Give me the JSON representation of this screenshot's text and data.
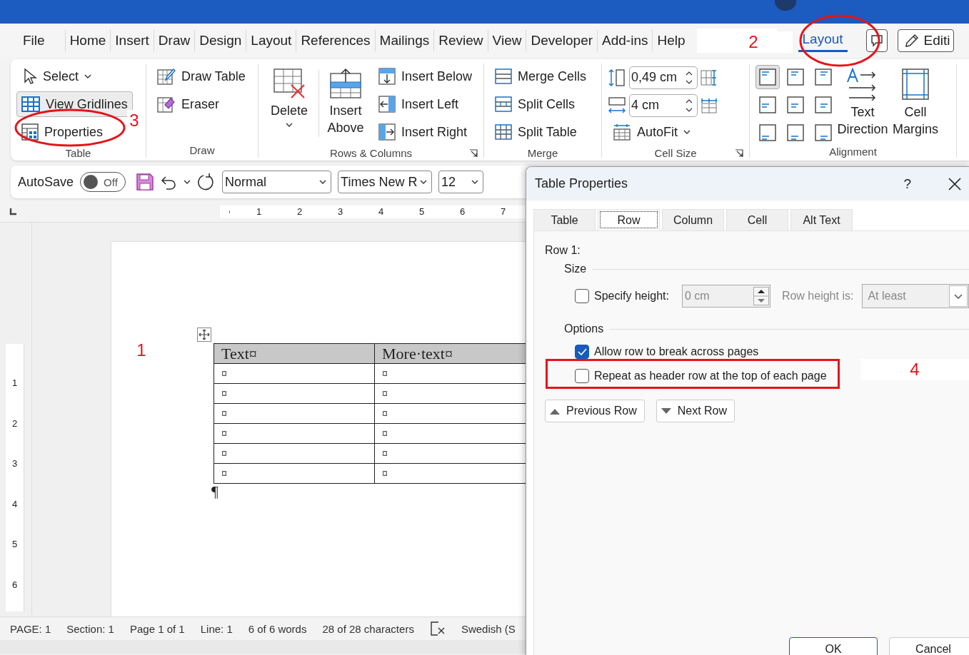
{
  "menu_tabs": [
    {
      "label": "File",
      "selected": false
    },
    {
      "label": "Home",
      "selected": false
    },
    {
      "label": "Insert",
      "selected": false
    },
    {
      "label": "Draw",
      "selected": false
    },
    {
      "label": "Design",
      "selected": false
    },
    {
      "label": "Layout",
      "selected": false
    },
    {
      "label": "References",
      "selected": false
    },
    {
      "label": "Mailings",
      "selected": false
    },
    {
      "label": "Review",
      "selected": false
    },
    {
      "label": "View",
      "selected": false
    },
    {
      "label": "Developer",
      "selected": false
    },
    {
      "label": "Add-ins",
      "selected": false
    },
    {
      "label": "Help",
      "selected": false
    }
  ],
  "table_tab": {
    "label": "Layout",
    "selected": true
  },
  "editing_button": "Editi",
  "ribbon": {
    "table_group": {
      "label": "Table",
      "select": "Select",
      "gridlines": {
        "label": "View Gridlines",
        "on": true
      },
      "properties": "Properties"
    },
    "draw_group": {
      "label": "Draw",
      "draw_table": "Draw Table",
      "eraser": "Eraser"
    },
    "rows_columns_group": {
      "label": "Rows & Columns",
      "delete": "Delete",
      "insert_above": "Insert Above",
      "insert_below": "Insert Below",
      "insert_left": "Insert Left",
      "insert_right": "Insert Right"
    },
    "merge_group": {
      "label": "Merge",
      "items": [
        "Merge Cells",
        "Split Cells",
        "Split Table"
      ]
    },
    "cell_size_group": {
      "label": "Cell Size",
      "height": "0,49 cm",
      "width": "4 cm",
      "autofit": "AutoFit"
    },
    "alignment_group": {
      "label": "Alignment",
      "buttons": [
        {
          "selected": true
        },
        {
          "selected": false
        },
        {
          "selected": false
        },
        {
          "selected": false
        },
        {
          "selected": false
        },
        {
          "selected": false
        },
        {
          "selected": false
        },
        {
          "selected": false
        },
        {
          "selected": false
        }
      ],
      "text_direction": "Text Direction",
      "cell_margins": "Cell Margins"
    }
  },
  "quick_access": {
    "autosave": {
      "label": "AutoSave",
      "on": false,
      "state": "Off"
    },
    "style": "Normal",
    "font": "Times New R",
    "size": "12"
  },
  "ruler": {
    "horizontal": [
      "1",
      "2",
      "3",
      "4",
      "5",
      "6",
      "7"
    ],
    "vertical": [
      "1",
      "2",
      "3",
      "4",
      "5",
      "6"
    ]
  },
  "document": {
    "table": {
      "header": [
        "Text¤",
        "More·text¤"
      ],
      "rows": [
        [
          "¤",
          "¤"
        ],
        [
          "¤",
          "¤"
        ],
        [
          "¤",
          "¤"
        ],
        [
          "¤",
          "¤"
        ],
        [
          "¤",
          "¤"
        ],
        [
          "¤",
          "¤"
        ]
      ]
    },
    "end_mark": "¶"
  },
  "status_bar": {
    "items": [
      "PAGE: 1",
      "Section: 1",
      "Page 1 of 1",
      "Line: 1",
      "6 of 6 words",
      "28 of 28 characters"
    ],
    "language": "Swedish (S"
  },
  "dialog": {
    "title": "Table Properties",
    "help": "?",
    "tabs": [
      {
        "label": "Table",
        "selected": false
      },
      {
        "label": "Row",
        "selected": true
      },
      {
        "label": "Column",
        "selected": false
      },
      {
        "label": "Cell",
        "selected": false
      },
      {
        "label": "Alt Text",
        "selected": false
      }
    ],
    "row_label": "Row 1:",
    "size_section": "Size",
    "specify_height": {
      "label": "Specify height:",
      "checked": false
    },
    "height_field": {
      "value": "0 cm",
      "disabled": true
    },
    "row_height_label": "Row height is:",
    "row_height": {
      "value": "At least",
      "disabled": true
    },
    "options_section": "Options",
    "options": [
      {
        "label": "Allow row to break across pages",
        "checked": true
      },
      {
        "label": "Repeat as header row at the top of each page",
        "checked": false
      }
    ],
    "nav_buttons": [
      "Previous Row",
      "Next Row"
    ],
    "buttons": [
      "OK",
      "Cancel"
    ]
  },
  "annotations": [
    {
      "label": "1"
    },
    {
      "label": "2"
    },
    {
      "label": "3"
    },
    {
      "label": "4"
    }
  ]
}
